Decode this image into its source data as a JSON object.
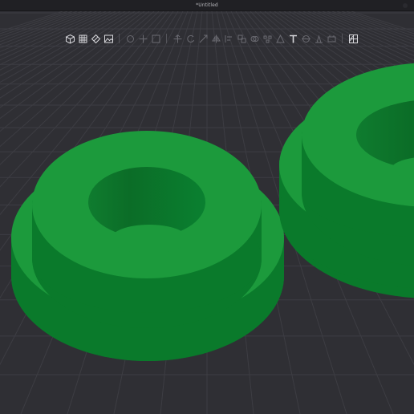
{
  "window": {
    "title": "*Untitled"
  },
  "toolbar": {
    "groups": [
      [
        {
          "name": "perspective-cube-icon",
          "state": "active"
        },
        {
          "name": "grid-icon",
          "state": "active"
        },
        {
          "name": "measure-icon",
          "state": "active"
        },
        {
          "name": "render-mode-icon",
          "state": "active"
        }
      ],
      [
        {
          "name": "rotate-view-icon",
          "state": "dim"
        },
        {
          "name": "pan-view-icon",
          "state": "dim"
        },
        {
          "name": "zoom-view-icon",
          "state": "dim"
        }
      ],
      [
        {
          "name": "move-tool-icon",
          "state": "dim"
        },
        {
          "name": "rotate-tool-icon",
          "state": "dim"
        },
        {
          "name": "scale-tool-icon",
          "state": "dim"
        },
        {
          "name": "mirror-tool-icon",
          "state": "dim"
        },
        {
          "name": "align-tool-icon",
          "state": "dim"
        },
        {
          "name": "group-tool-icon",
          "state": "dim"
        },
        {
          "name": "boolean-tool-icon",
          "state": "dim"
        },
        {
          "name": "array-tool-icon",
          "state": "dim"
        },
        {
          "name": "pattern-tool-icon",
          "state": "dim"
        },
        {
          "name": "text-tool-icon",
          "state": "active"
        },
        {
          "name": "cut-tool-icon",
          "state": "dim"
        },
        {
          "name": "support-tool-icon",
          "state": "dim"
        },
        {
          "name": "place-on-face-icon",
          "state": "dim"
        }
      ],
      [
        {
          "name": "view-layout-icon",
          "state": "active"
        }
      ]
    ]
  },
  "colors": {
    "background": "#2f2f34",
    "grid_line": "#3d3d43",
    "part_top": "#1c9a3c",
    "part_side": "#0b7d2b",
    "part_dark": "#06611f",
    "part_inner": "#0a6d26"
  }
}
